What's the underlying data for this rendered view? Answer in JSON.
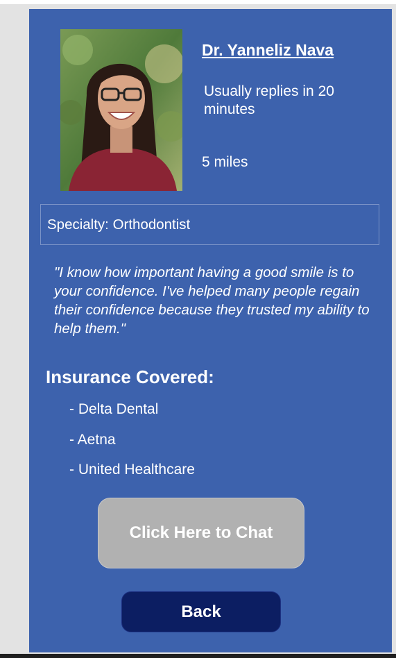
{
  "doctor": {
    "name": "Dr. Yanneliz Nava",
    "reply_time": "Usually replies in 20 minutes",
    "distance": "5 miles",
    "specialty": "Specialty: Orthodontist",
    "quote": "\"I know how important having a good smile is to your confidence. I've helped many people regain their confidence because they trusted my ability to help them.\""
  },
  "insurance": {
    "heading": "Insurance Covered:",
    "items": [
      "- Delta Dental",
      "- Aetna",
      "- United Healthcare"
    ]
  },
  "actions": {
    "chat_label": "Click Here to Chat",
    "back_label": "Back"
  },
  "colors": {
    "panel": "#3d62ad",
    "chat_button": "#b1b1b1",
    "back_button": "#0c1e62"
  }
}
